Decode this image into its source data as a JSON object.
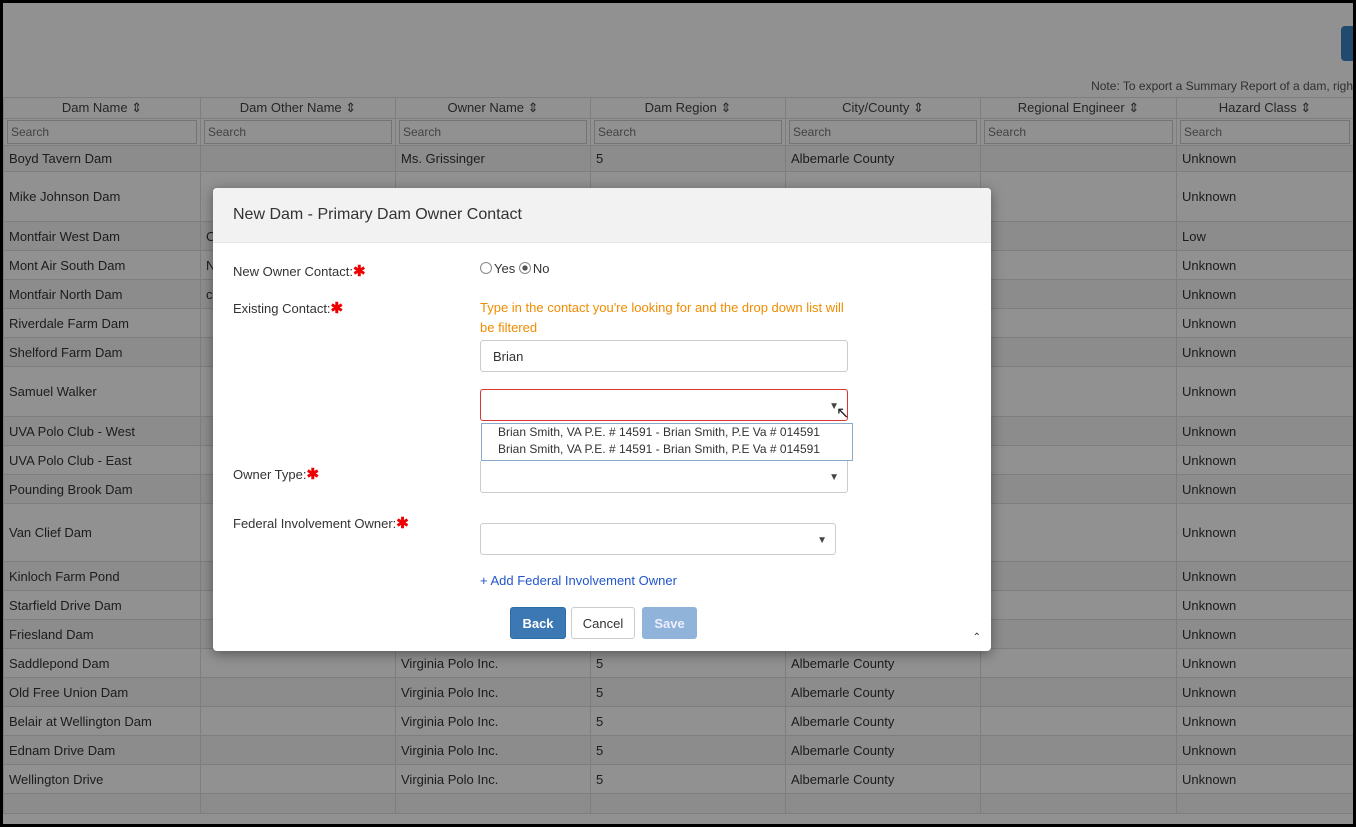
{
  "note": "Note: To export a Summary Report of a dam, righ",
  "columns": [
    "Dam Name",
    "Dam Other Name",
    "Owner Name",
    "Dam Region",
    "City/County",
    "Regional Engineer",
    "Hazard Class"
  ],
  "sort_icon": "⇕ sort-icon",
  "search_placeholder": "Search",
  "rows": [
    {
      "dam": "Boyd Tavern Dam",
      "other": "",
      "owner": "Ms. Grissinger",
      "region": "5",
      "city": "Albemarle County",
      "eng": "",
      "hazard": "Unknown"
    },
    {
      "dam": "Mike Johnson Dam",
      "other": "",
      "owner": "",
      "region": "",
      "city": "",
      "eng": "",
      "hazard": "Unknown"
    },
    {
      "dam": "Montfair West Dam",
      "other": "C",
      "owner": "",
      "region": "",
      "city": "",
      "eng": "",
      "hazard": "Low"
    },
    {
      "dam": "Mont Air South Dam",
      "other": "N",
      "owner": "",
      "region": "",
      "city": "",
      "eng": "",
      "hazard": "Unknown"
    },
    {
      "dam": "Montfair North Dam",
      "other": "c",
      "owner": "",
      "region": "",
      "city": "",
      "eng": "",
      "hazard": "Unknown"
    },
    {
      "dam": "Riverdale Farm Dam",
      "other": "",
      "owner": "",
      "region": "",
      "city": "",
      "eng": "",
      "hazard": "Unknown"
    },
    {
      "dam": "Shelford Farm Dam",
      "other": "",
      "owner": "",
      "region": "",
      "city": "",
      "eng": "",
      "hazard": "Unknown"
    },
    {
      "dam": "Samuel Walker",
      "other": "",
      "owner": "",
      "region": "",
      "city": "",
      "eng": "",
      "hazard": "Unknown"
    },
    {
      "dam": "UVA Polo Club - West",
      "other": "",
      "owner": "",
      "region": "",
      "city": "",
      "eng": "",
      "hazard": "Unknown"
    },
    {
      "dam": "UVA Polo Club - East",
      "other": "",
      "owner": "",
      "region": "",
      "city": "",
      "eng": "",
      "hazard": "Unknown"
    },
    {
      "dam": "Pounding Brook Dam",
      "other": "",
      "owner": "",
      "region": "",
      "city": "",
      "eng": "",
      "hazard": "Unknown"
    },
    {
      "dam": "Van Clief Dam",
      "other": "",
      "owner": "",
      "region": "",
      "city": "",
      "eng": "",
      "hazard": "Unknown"
    },
    {
      "dam": "Kinloch Farm Pond",
      "other": "",
      "owner": "",
      "region": "",
      "city": "",
      "eng": "",
      "hazard": "Unknown"
    },
    {
      "dam": "Starfield Drive Dam",
      "other": "",
      "owner": "",
      "region": "",
      "city": "",
      "eng": "",
      "hazard": "Unknown"
    },
    {
      "dam": "Friesland Dam",
      "other": "",
      "owner": "Virginia Polo Inc.",
      "region": "5",
      "city": "Albemarle County",
      "eng": "",
      "hazard": "Unknown"
    },
    {
      "dam": "Saddlepond Dam",
      "other": "",
      "owner": "Virginia Polo Inc.",
      "region": "5",
      "city": "Albemarle County",
      "eng": "",
      "hazard": "Unknown"
    },
    {
      "dam": "Old Free Union Dam",
      "other": "",
      "owner": "Virginia Polo Inc.",
      "region": "5",
      "city": "Albemarle County",
      "eng": "",
      "hazard": "Unknown"
    },
    {
      "dam": "Belair at Wellington Dam",
      "other": "",
      "owner": "Virginia Polo Inc.",
      "region": "5",
      "city": "Albemarle County",
      "eng": "",
      "hazard": "Unknown"
    },
    {
      "dam": "Ednam Drive Dam",
      "other": "",
      "owner": "Virginia Polo Inc.",
      "region": "5",
      "city": "Albemarle County",
      "eng": "",
      "hazard": "Unknown"
    },
    {
      "dam": "Wellington Drive",
      "other": "",
      "owner": "Virginia Polo Inc.",
      "region": "5",
      "city": "Albemarle County",
      "eng": "",
      "hazard": "Unknown"
    },
    {
      "dam": "",
      "other": "",
      "owner": "",
      "region": "",
      "city": "",
      "eng": "",
      "hazard": ""
    }
  ],
  "modal": {
    "title": "New Dam - Primary Dam Owner Contact",
    "new_owner_label": "New Owner Contact:",
    "yes_label": "Yes",
    "no_label": "No",
    "existing_label": "Existing Contact:",
    "hint": "Type in the contact you're looking for and the drop down list will be filtered",
    "filter_value": "Brian",
    "select_value": "",
    "options": [
      "Brian Smith, VA P.E. # 14591 - Brian Smith, P.E Va # 014591",
      "Brian Smith, VA P.E. # 14591 - Brian Smith, P.E Va # 014591"
    ],
    "owner_type_label": "Owner Type:",
    "owner_type_value": "",
    "federal_label": "Federal Involvement Owner:",
    "federal_value": "",
    "add_federal_link": "+ Add Federal Involvement Owner",
    "back": "Back",
    "cancel": "Cancel",
    "save": "Save",
    "required_mark": "✱",
    "caret": "▼",
    "scroll_up": "⌃"
  }
}
